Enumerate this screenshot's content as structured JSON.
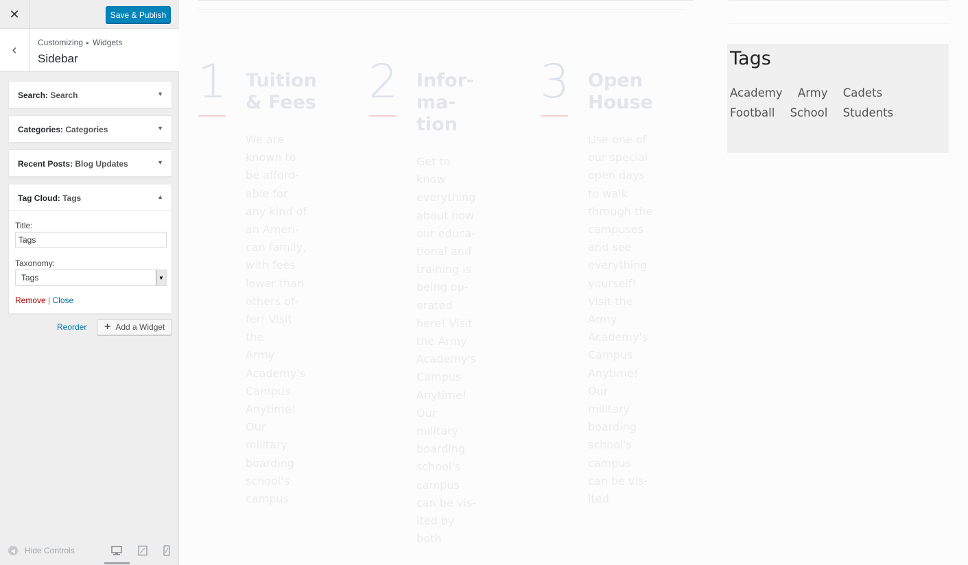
{
  "customizer": {
    "close_icon": "close-icon",
    "publish_label": "Save & Publish",
    "breadcrumb": {
      "root": "Customizing",
      "child": "Widgets"
    },
    "section_title": "Sidebar",
    "widgets": [
      {
        "type": "Search:",
        "title": "Search"
      },
      {
        "type": "Categories:",
        "title": "Categories"
      },
      {
        "type": "Recent Posts:",
        "title": "Blog Updates"
      },
      {
        "type": "Tag Cloud:",
        "title": "Tags"
      }
    ],
    "tag_cloud_form": {
      "title_label": "Title:",
      "title_value": "Tags",
      "taxonomy_label": "Taxonomy:",
      "taxonomy_value": "Tags",
      "remove_label": "Remove",
      "separator": "|",
      "close_label": "Close"
    },
    "reorder_label": "Reorder",
    "add_widget_label": "Add a Widget",
    "hide_controls_label": "Hide Controls",
    "accent_color": "#0085ba"
  },
  "preview": {
    "features": [
      {
        "number": "1",
        "title": "Tuition\n& Fees",
        "text": "We are\nknown to\nbe afford-\nable for\nany kind of\nan Ameri-\ncan family,\nwith fees\nlower than\nothers of-\nfer! Visit the\nArmy\nAcademy's\nCampus\nAnytime!\nOur military\nboarding\nschool's\ncampus"
      },
      {
        "number": "2",
        "title": "Infor-\nma-\ntion",
        "text": "Get to know\neverything\nabout how\nour educa-\ntional and\ntraining is\nbeing op-\nerated\nhere! Visit\nthe Army\nAcademy's\nCampus\nAnytime!\nOur military\nboarding\nschool's\ncampus\ncan be vis-\nited by both"
      },
      {
        "number": "3",
        "title": "Open\nHouse",
        "text": "Use one of\nour special\nopen days\nto walk\nthrough the\ncampuses\nand see\neverything\nyourself!\nVisit the\nArmy\nAcademy's\nCampus\nAnytime!\nOur military\nboarding\nschool's\ncampus\ncan be vis-\nited"
      }
    ],
    "tags_widget": {
      "title": "Tags",
      "tags": [
        "Academy",
        "Army",
        "Cadets",
        "Football",
        "School",
        "Students"
      ]
    }
  }
}
